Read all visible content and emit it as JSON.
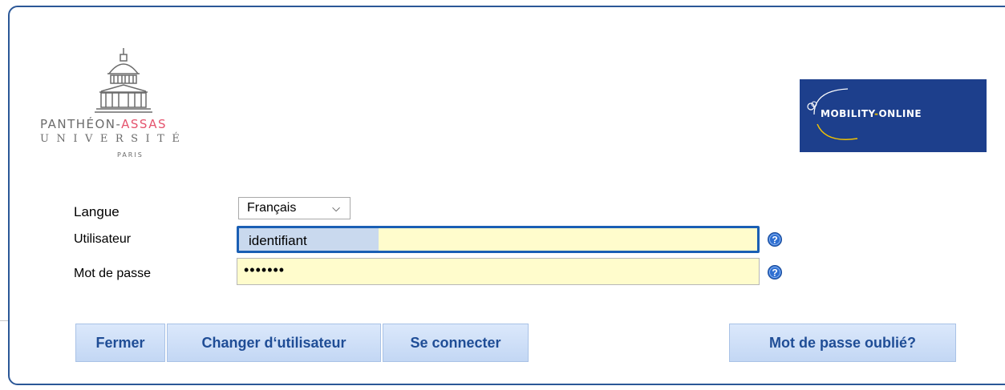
{
  "university_logo": {
    "line1_main": "PANTHÉON-",
    "line1_accent": "ASSAS",
    "line2": "UNIVERSITÉ",
    "line3": "PARIS",
    "accent_color": "#e5546e"
  },
  "partner_logo": {
    "name_main": "MOBILITY",
    "name_sep": "-",
    "name_tail": "ONLINE",
    "background": "#1d3f8c",
    "accent_color": "#f2c200"
  },
  "form": {
    "language_label": "Langue",
    "language_value": "Français",
    "user_label": "Utilisateur",
    "user_autofill": "identifiant",
    "password_label": "Mot de passe",
    "password_mask": "•••••••",
    "help_icon": "help-icon"
  },
  "buttons": {
    "close": "Fermer",
    "change_user": "Changer d‘utilisateur",
    "login": "Se connecter",
    "forgot": "Mot de passe oublié?"
  }
}
